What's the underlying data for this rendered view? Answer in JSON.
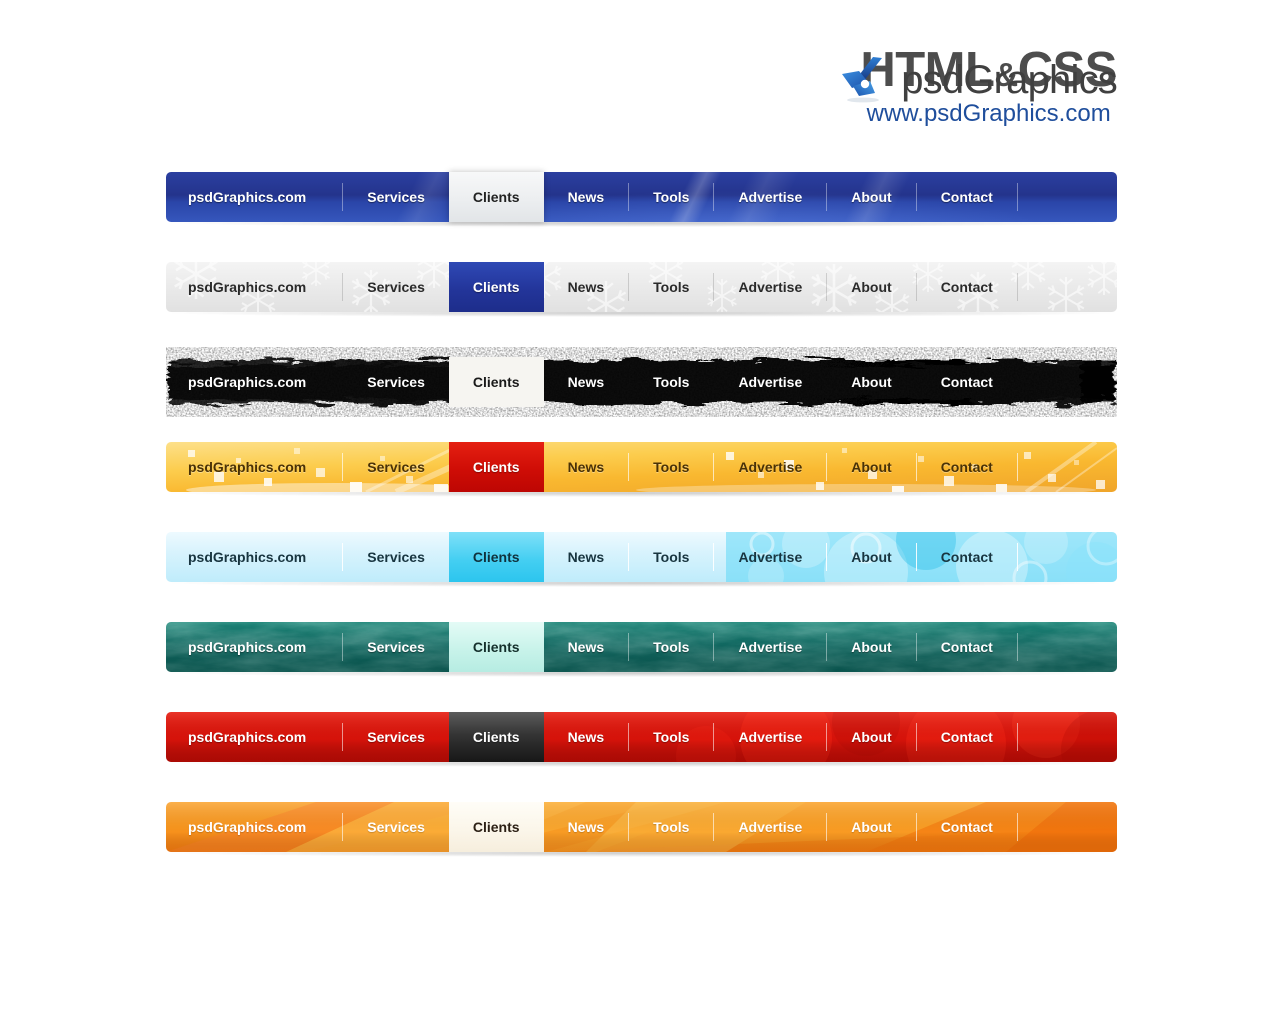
{
  "header": {
    "title_main": "HTML",
    "title_amp": "&",
    "title_second": "CSS",
    "url": "www.psdGraphics.com",
    "logo_text": "psdGraphics",
    "logo_icon": "bird-logo-icon"
  },
  "nav_labels": {
    "brand": "psdGraphics.com",
    "services": "Services",
    "clients": "Clients",
    "news": "News",
    "tools": "Tools",
    "advertise": "Advertise",
    "about": "About",
    "contact": "Contact"
  },
  "bars": [
    {
      "id": "bar-blue",
      "name": "blue-glossy-navbar",
      "active": "Clients",
      "base_color": "#24348c",
      "active_color": "#eceef0",
      "text_color": "#ffffff",
      "items": [
        "psdGraphics.com",
        "Services",
        "Clients",
        "News",
        "Tools",
        "Advertise",
        "About",
        "Contact"
      ]
    },
    {
      "id": "bar-snow",
      "name": "white-snowflake-navbar",
      "active": "Clients",
      "base_color": "#eaeaea",
      "active_color": "#23359a",
      "text_color": "#2a2a2a",
      "items": [
        "psdGraphics.com",
        "Services",
        "Clients",
        "News",
        "Tools",
        "Advertise",
        "About",
        "Contact"
      ]
    },
    {
      "id": "bar-grunge",
      "name": "black-grunge-navbar",
      "active": "Clients",
      "base_color": "#121212",
      "active_color": "#f6f5f1",
      "text_color": "#ffffff",
      "items": [
        "psdGraphics.com",
        "Services",
        "Clients",
        "News",
        "Tools",
        "Advertise",
        "About",
        "Contact"
      ]
    },
    {
      "id": "bar-yellow",
      "name": "yellow-confetti-navbar",
      "active": "Clients",
      "base_color": "#f9b830",
      "active_color": "#cf0d06",
      "text_color": "#4a3206",
      "items": [
        "psdGraphics.com",
        "Services",
        "Clients",
        "News",
        "Tools",
        "Advertise",
        "About",
        "Contact"
      ]
    },
    {
      "id": "bar-aqua",
      "name": "light-blue-bubbles-navbar",
      "active": "Clients",
      "base_color": "#bfecfb",
      "active_color": "#45cff2",
      "text_color": "#183540",
      "items": [
        "psdGraphics.com",
        "Services",
        "Clients",
        "News",
        "Tools",
        "Advertise",
        "About",
        "Contact"
      ]
    },
    {
      "id": "bar-teal",
      "name": "teal-clouds-navbar",
      "active": "Clients",
      "base_color": "#14766e",
      "active_color": "#c8f3ea",
      "text_color": "#ffffff",
      "items": [
        "psdGraphics.com",
        "Services",
        "Clients",
        "News",
        "Tools",
        "Advertise",
        "About",
        "Contact"
      ]
    },
    {
      "id": "bar-red",
      "name": "red-navbar",
      "active": "Clients",
      "base_color": "#d9140b",
      "active_color": "#343434",
      "text_color": "#ffffff",
      "items": [
        "psdGraphics.com",
        "Services",
        "Clients",
        "News",
        "Tools",
        "Advertise",
        "About",
        "Contact"
      ]
    },
    {
      "id": "bar-orange",
      "name": "orange-navbar",
      "active": "Clients",
      "base_color": "#f8971f",
      "active_color": "#fbf6ea",
      "text_color": "#ffffff",
      "items": [
        "psdGraphics.com",
        "Services",
        "Clients",
        "News",
        "Tools",
        "Advertise",
        "About",
        "Contact"
      ]
    }
  ]
}
